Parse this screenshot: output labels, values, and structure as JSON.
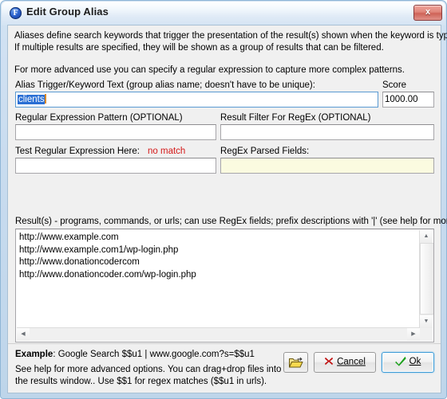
{
  "window": {
    "title": "Edit Group Alias",
    "icon": "farr-f-icon",
    "close_label": "x"
  },
  "description": {
    "line1": "Aliases define search keywords that trigger the presentation of the result(s) shown when the keyword is typed.",
    "line2": "If multiple results are specified, they will be shown as a group of results that can be filtered.",
    "line3": "For more advanced use you can specify a regular expression to capture more complex patterns."
  },
  "fields": {
    "trigger": {
      "label": "Alias Trigger/Keyword Text (group alias name; doesn't have to be unique):",
      "value": "clients",
      "selected": true
    },
    "score": {
      "label": "Score",
      "value": "1000.00"
    },
    "regex_pattern": {
      "label": "Regular Expression Pattern (OPTIONAL)",
      "value": ""
    },
    "result_filter": {
      "label": "Result Filter For RegEx (OPTIONAL)",
      "value": ""
    },
    "test_regex": {
      "label": "Test Regular Expression Here:",
      "status": "no match",
      "status_color": "#d41919",
      "value": ""
    },
    "parsed_fields": {
      "label": "RegEx Parsed Fields:",
      "value": "",
      "background": "#fbfbe0"
    }
  },
  "results": {
    "label": "Result(s) - programs, commands, or urls; can use RegEx fields; prefix descriptions with '|' (see help for more info)",
    "lines": [
      "http://www.example.com",
      "http://www.example.com1/wp-login.php",
      "http://www.donationcodercom",
      "http://www.donationcoder.com/wp-login.php"
    ]
  },
  "footer": {
    "example_prefix": "Example",
    "example_text": ": Google Search $$u1 | www.google.com?s=$$u1",
    "help_line1": "See help for more advanced options.  You can drag+drop files into",
    "help_line2": "the results window.. Use $$1 for regex matches ($$u1 in urls).",
    "browse_label": "",
    "cancel_label": "Cancel",
    "ok_label": "Ok"
  },
  "scrollbars": {
    "up_arrow": "▲",
    "down_arrow": "▼",
    "left_arrow": "◀",
    "right_arrow": "▶"
  }
}
